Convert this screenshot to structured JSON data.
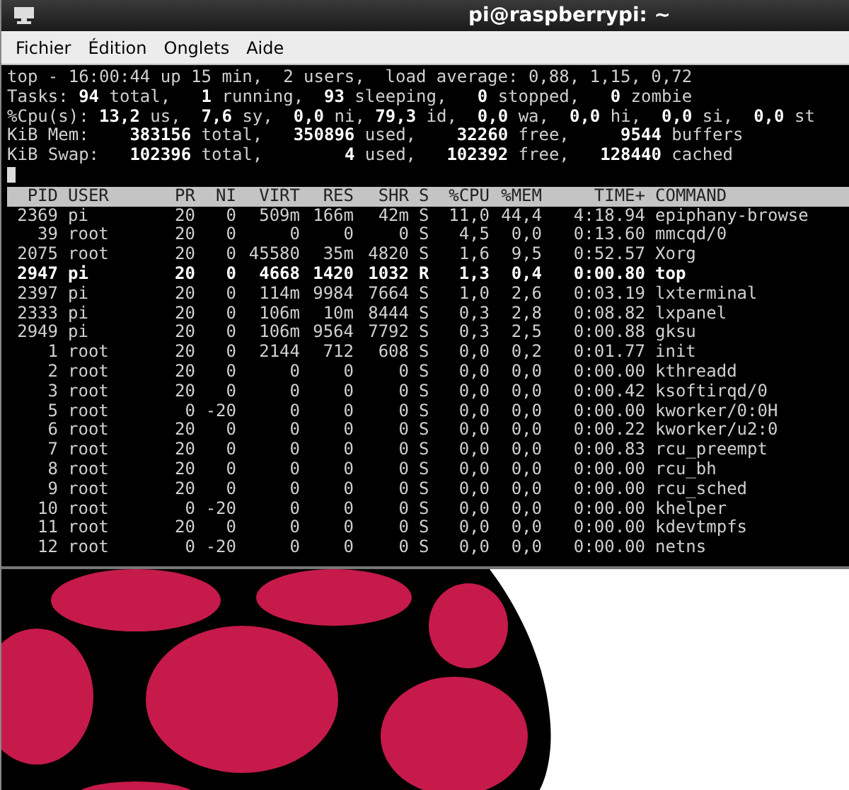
{
  "window": {
    "title": "pi@raspberrypi: ~"
  },
  "menu": [
    "Fichier",
    "Édition",
    "Onglets",
    "Aide"
  ],
  "summary": [
    "top - 16:00:44 up 15 min,  2 users,  load average: 0,88, 1,15, 0,72",
    "Tasks: **94** total,   **1** running,  **93** sleeping,   **0** stopped,   **0** zombie",
    "%Cpu(s): **13,2** us,  **7,6** sy,  **0,0** ni, **79,3** id,  **0,0** wa,  **0,0** hi,  **0,0** si,  **0,0** st",
    "KiB Mem:    **383156** total,   **350896** used,    **32260** free,     **9544** buffers",
    "KiB Swap:   **102396** total,        **4** used,   **102392** free,   **128440** cached"
  ],
  "table": {
    "columns": [
      "PID",
      "USER",
      "PR",
      "NI",
      "VIRT",
      "RES",
      "SHR",
      "S",
      "%CPU",
      "%MEM",
      "TIME+",
      "COMMAND"
    ],
    "rows": [
      {
        "cells": [
          "2369",
          "pi",
          "20",
          "0",
          "509m",
          "166m",
          "42m",
          "S",
          "11,0",
          "44,4",
          "4:18.94",
          "epiphany-browse"
        ],
        "highlighted": false
      },
      {
        "cells": [
          "39",
          "root",
          "20",
          "0",
          "0",
          "0",
          "0",
          "S",
          "4,5",
          "0,0",
          "0:13.60",
          "mmcqd/0"
        ],
        "highlighted": false
      },
      {
        "cells": [
          "2075",
          "root",
          "20",
          "0",
          "45580",
          "35m",
          "4820",
          "S",
          "1,6",
          "9,5",
          "0:52.57",
          "Xorg"
        ],
        "highlighted": false
      },
      {
        "cells": [
          "2947",
          "pi",
          "20",
          "0",
          "4668",
          "1420",
          "1032",
          "R",
          "1,3",
          "0,4",
          "0:00.80",
          "top"
        ],
        "highlighted": true
      },
      {
        "cells": [
          "2397",
          "pi",
          "20",
          "0",
          "114m",
          "9984",
          "7664",
          "S",
          "1,0",
          "2,6",
          "0:03.19",
          "lxterminal"
        ],
        "highlighted": false
      },
      {
        "cells": [
          "2333",
          "pi",
          "20",
          "0",
          "106m",
          "10m",
          "8444",
          "S",
          "0,3",
          "2,8",
          "0:08.82",
          "lxpanel"
        ],
        "highlighted": false
      },
      {
        "cells": [
          "2949",
          "pi",
          "20",
          "0",
          "106m",
          "9564",
          "7792",
          "S",
          "0,3",
          "2,5",
          "0:00.88",
          "gksu"
        ],
        "highlighted": false
      },
      {
        "cells": [
          "1",
          "root",
          "20",
          "0",
          "2144",
          "712",
          "608",
          "S",
          "0,0",
          "0,2",
          "0:01.77",
          "init"
        ],
        "highlighted": false
      },
      {
        "cells": [
          "2",
          "root",
          "20",
          "0",
          "0",
          "0",
          "0",
          "S",
          "0,0",
          "0,0",
          "0:00.00",
          "kthreadd"
        ],
        "highlighted": false
      },
      {
        "cells": [
          "3",
          "root",
          "20",
          "0",
          "0",
          "0",
          "0",
          "S",
          "0,0",
          "0,0",
          "0:00.42",
          "ksoftirqd/0"
        ],
        "highlighted": false
      },
      {
        "cells": [
          "5",
          "root",
          "0",
          "-20",
          "0",
          "0",
          "0",
          "S",
          "0,0",
          "0,0",
          "0:00.00",
          "kworker/0:0H"
        ],
        "highlighted": false
      },
      {
        "cells": [
          "6",
          "root",
          "20",
          "0",
          "0",
          "0",
          "0",
          "S",
          "0,0",
          "0,0",
          "0:00.22",
          "kworker/u2:0"
        ],
        "highlighted": false
      },
      {
        "cells": [
          "7",
          "root",
          "20",
          "0",
          "0",
          "0",
          "0",
          "S",
          "0,0",
          "0,0",
          "0:00.83",
          "rcu_preempt"
        ],
        "highlighted": false
      },
      {
        "cells": [
          "8",
          "root",
          "20",
          "0",
          "0",
          "0",
          "0",
          "S",
          "0,0",
          "0,0",
          "0:00.00",
          "rcu_bh"
        ],
        "highlighted": false
      },
      {
        "cells": [
          "9",
          "root",
          "20",
          "0",
          "0",
          "0",
          "0",
          "S",
          "0,0",
          "0,0",
          "0:00.00",
          "rcu_sched"
        ],
        "highlighted": false
      },
      {
        "cells": [
          "10",
          "root",
          "0",
          "-20",
          "0",
          "0",
          "0",
          "S",
          "0,0",
          "0,0",
          "0:00.00",
          "khelper"
        ],
        "highlighted": false
      },
      {
        "cells": [
          "11",
          "root",
          "20",
          "0",
          "0",
          "0",
          "0",
          "S",
          "0,0",
          "0,0",
          "0:00.00",
          "kdevtmpfs"
        ],
        "highlighted": false
      },
      {
        "cells": [
          "12",
          "root",
          "0",
          "-20",
          "0",
          "0",
          "0",
          "S",
          "0,0",
          "0,0",
          "0:00.00",
          "netns"
        ],
        "highlighted": false
      }
    ]
  }
}
